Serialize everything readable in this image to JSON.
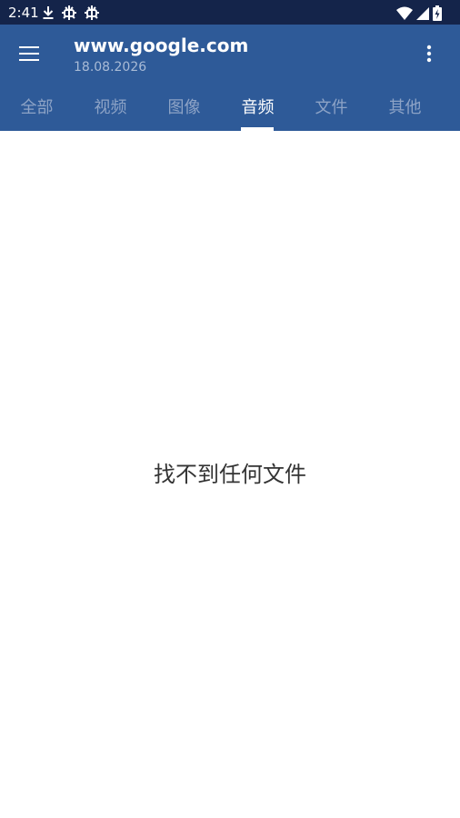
{
  "status_bar": {
    "time": "2:41",
    "left_icons": [
      "download-icon",
      "bug-icon",
      "bug-icon"
    ],
    "right_icons": [
      "wifi-icon",
      "signal-icon",
      "battery-charging-icon"
    ]
  },
  "app_bar": {
    "title": "www.google.com",
    "subtitle": "18.08.2026",
    "menu_icon": "hamburger-menu-icon",
    "overflow_icon": "more-vertical-icon",
    "background_color": "#2e5a98"
  },
  "tabs": [
    {
      "label": "全部",
      "active": false
    },
    {
      "label": "视频",
      "active": false
    },
    {
      "label": "图像",
      "active": false
    },
    {
      "label": "音频",
      "active": true
    },
    {
      "label": "文件",
      "active": false
    },
    {
      "label": "其他",
      "active": false
    }
  ],
  "main": {
    "empty_message": "找不到任何文件"
  }
}
